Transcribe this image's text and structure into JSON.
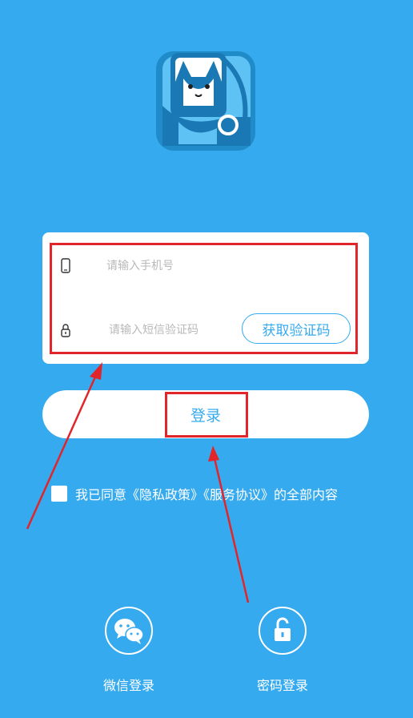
{
  "login_form": {
    "phone_placeholder": "请输入手机号",
    "code_placeholder": "请输入短信验证码",
    "get_code_label": "获取验证码"
  },
  "login_button_label": "登录",
  "agreement_text": "我已同意《隐私政策》《服务协议》的全部内容",
  "social": {
    "wechat_label": "微信登录",
    "password_label": "密码登录"
  },
  "colors": {
    "background": "#36aaee",
    "accent": "#36aaee",
    "annotation_red": "#e1252b",
    "white": "#ffffff"
  },
  "icons": [
    "app-logo",
    "phone-icon",
    "lock-icon",
    "wechat-icon",
    "unlock-icon"
  ]
}
